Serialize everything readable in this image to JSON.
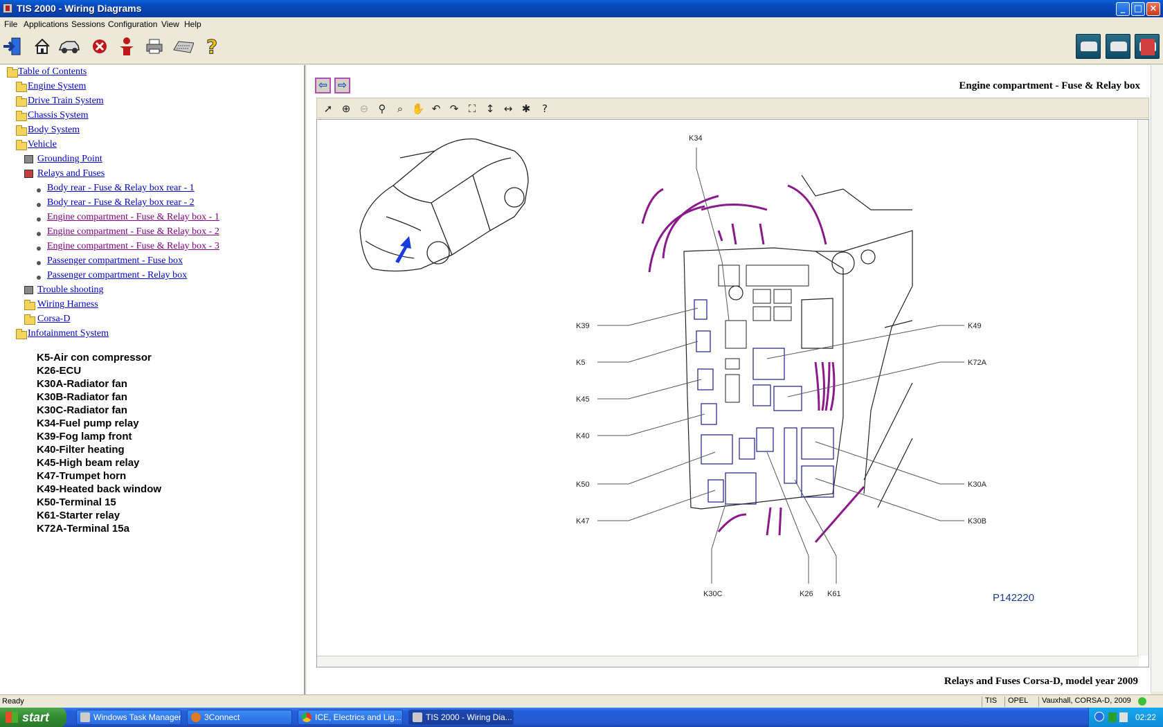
{
  "window": {
    "title": "TIS 2000 - Wiring Diagrams"
  },
  "menu": [
    "File",
    "Applications",
    "Sessions",
    "Configuration",
    "View",
    "Help"
  ],
  "toolbar": {
    "icons": [
      "exit-icon",
      "home-icon",
      "vehicle-icon",
      "stop-icon",
      "person-icon",
      "print-icon",
      "keyboard-icon",
      "help-icon"
    ]
  },
  "tree": {
    "root": "Table of Contents",
    "items": [
      "Engine System",
      "Drive Train System",
      "Chassis System",
      "Body System",
      "Vehicle",
      "Grounding Point",
      "Relays and Fuses",
      "Body rear - Fuse & Relay box rear - 1",
      "Body rear - Fuse & Relay box rear - 2",
      "Engine compartment - Fuse & Relay box - 1",
      "Engine compartment - Fuse & Relay box - 2",
      "Engine compartment - Fuse & Relay box - 3",
      "Passenger compartment - Fuse box",
      "Passenger compartment - Relay box",
      "Trouble shooting",
      "Wiring Harness",
      "Corsa-D",
      "Infotainment System"
    ]
  },
  "legend": [
    "K5-Air con compressor",
    "K26-ECU",
    "K30A-Radiator fan",
    "K30B-Radiator fan",
    "K30C-Radiator fan",
    "K34-Fuel pump relay",
    "K39-Fog lamp front",
    "K40-Filter heating",
    "K45-High beam relay",
    "K47-Trumpet horn",
    "K49-Heated back window",
    "K50-Terminal 15",
    "K61-Starter relay",
    "K72A-Terminal 15a"
  ],
  "document": {
    "title": "Engine compartment - Fuse & Relay box",
    "caption": "Relays and Fuses Corsa-D, model year 2009",
    "diagram_id": "P142220",
    "labels": {
      "k34": "K34",
      "k39": "K39",
      "k5": "K5",
      "k45": "K45",
      "k40": "K40",
      "k50": "K50",
      "k47": "K47",
      "k49": "K49",
      "k72a": "K72A",
      "k30a": "K30A",
      "k30b": "K30B",
      "k30c": "K30C",
      "k26": "K26",
      "k61": "K61"
    }
  },
  "status": {
    "text": "Ready",
    "tis": "TIS",
    "make": "OPEL",
    "vehicle": "Vauxhall, CORSA-D, 2009"
  },
  "taskbar": {
    "start": "start",
    "tasks": [
      "Windows Task Manager",
      "3Connect",
      "ICE, Electrics and Lig...",
      "TIS 2000 - Wiring Dia..."
    ],
    "clock": "02:22"
  }
}
